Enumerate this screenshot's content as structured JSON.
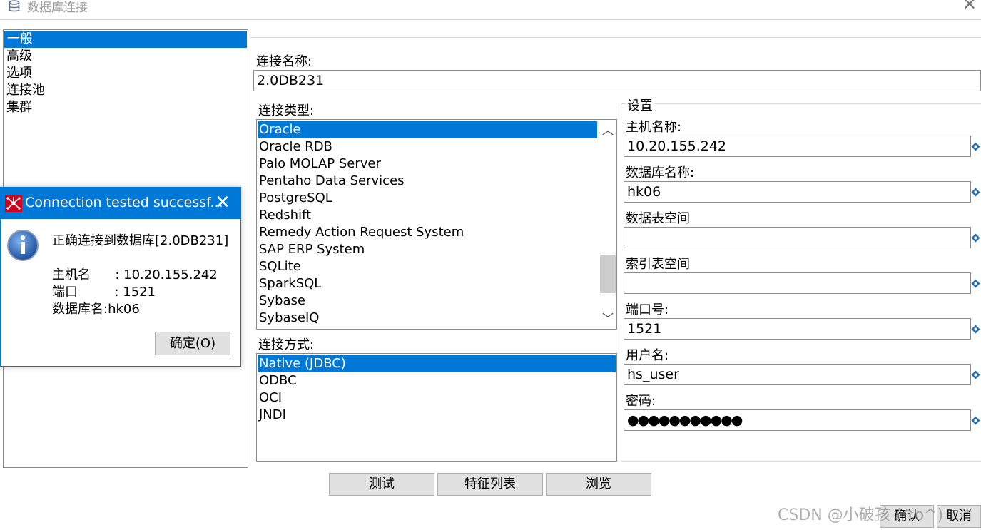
{
  "window": {
    "title": "数据库连接"
  },
  "nav": {
    "items": [
      "一般",
      "高级",
      "选项",
      "连接池",
      "集群"
    ],
    "selected": 0
  },
  "form": {
    "connection_name_label": "连接名称:",
    "connection_name_value": "2.0DB231",
    "connection_type_label": "连接类型:",
    "connection_types": [
      "Oracle",
      "Oracle RDB",
      "Palo MOLAP Server",
      "Pentaho Data Services",
      "PostgreSQL",
      "Redshift",
      "Remedy Action Request System",
      "SAP ERP System",
      "SQLite",
      "SparkSQL",
      "Sybase",
      "SybaseIQ"
    ],
    "connection_type_selected": 0,
    "access_label": "连接方式:",
    "access_methods": [
      "Native (JDBC)",
      "ODBC",
      "OCI",
      "JNDI"
    ],
    "access_selected": 0
  },
  "settings": {
    "title": "设置",
    "host_label": "主机名称:",
    "host_value": "10.20.155.242",
    "db_label": "数据库名称:",
    "db_value": "hk06",
    "tablespace_label": "数据表空间",
    "tablespace_value": "",
    "index_tablespace_label": "索引表空间",
    "index_tablespace_value": "",
    "port_label": "端口号:",
    "port_value": "1521",
    "user_label": "用户名:",
    "user_value": "hs_user",
    "password_label": "密码:",
    "password_value": "●●●●●●●●●●●"
  },
  "buttons": {
    "test": "测试",
    "features": "特征列表",
    "explore": "浏览",
    "ok": "确认",
    "cancel": "取消"
  },
  "dialog": {
    "title": "Connection tested successf...",
    "message": "正确连接到数据库[2.0DB231]",
    "host_line": "主机名      : 10.20.155.242",
    "port_line": "端口         : 1521",
    "db_line": "数据库名:hk06",
    "ok_label": "确定(O)"
  },
  "watermark": "CSDN @小破孩 (^o^)",
  "colors": {
    "selection": "#0078d7",
    "button_bg": "#e1e1e1",
    "variable_icon": "#1f6fbf",
    "app_icon_red": "#d0021b"
  }
}
